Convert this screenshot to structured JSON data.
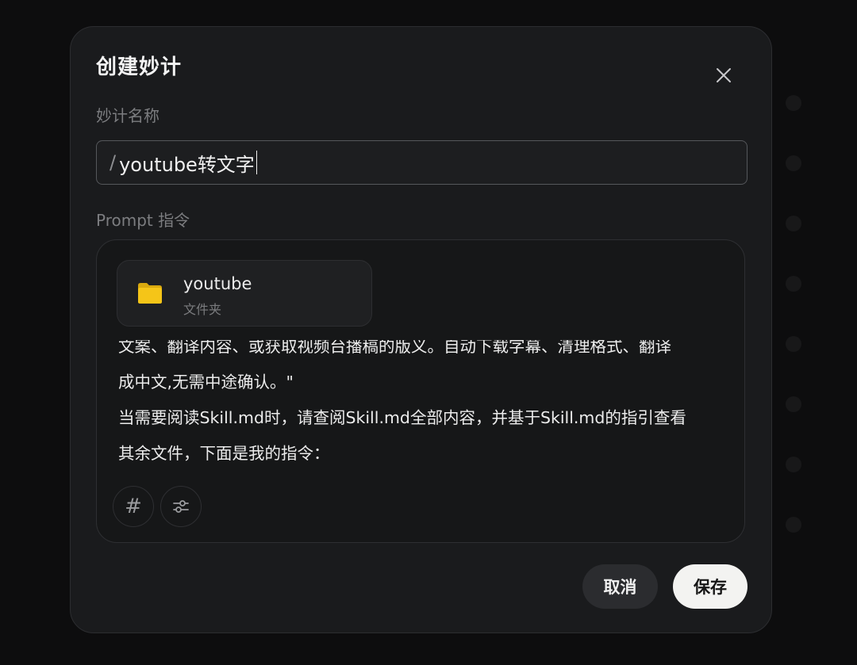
{
  "dialog": {
    "title": "创建妙计",
    "close_icon": "close-icon"
  },
  "name_field": {
    "label": "妙计名称",
    "prefix": "/",
    "value": "youtube转文字"
  },
  "prompt_field": {
    "label": "Prompt 指令",
    "attachment": {
      "icon": "folder-icon",
      "icon_color": "#F5C518",
      "name": "youtube",
      "type": "文件夹"
    },
    "text_lines": [
      "文案、翻译内容、或获取视频台播稿的版义。自动下载字幕、清理格式、翻译",
      "成中文,无需中途确认。\"",
      "当需要阅读Skill.md时，请查阅Skill.md全部内容，并基于Skill.md的指引查看",
      "其余文件，下面是我的指令："
    ],
    "tools": [
      {
        "icon": "hash-icon",
        "glyph": "#"
      },
      {
        "icon": "sliders-icon"
      }
    ]
  },
  "actions": {
    "cancel_label": "取消",
    "save_label": "保存"
  }
}
